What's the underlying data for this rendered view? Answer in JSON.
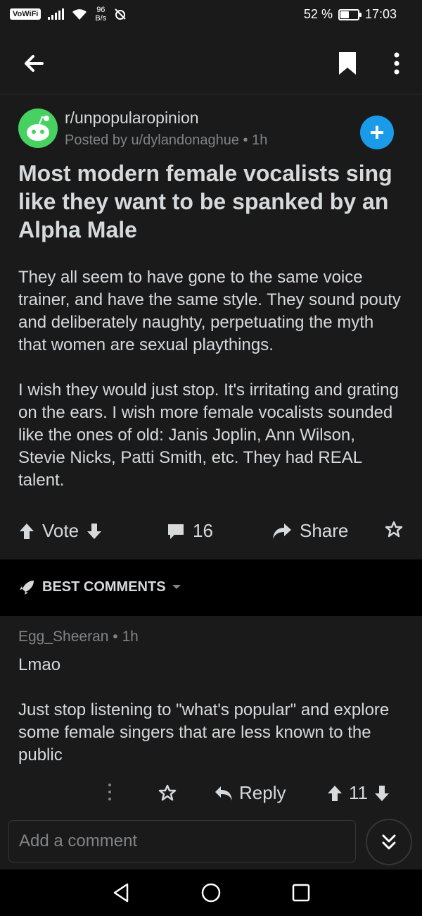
{
  "status": {
    "carrier_badge": "VoWiFi",
    "speed_value": "96",
    "speed_unit": "B/s",
    "battery_percent": "52 %",
    "battery_level": 0.52,
    "time": "17:03"
  },
  "appbar": {
    "back_icon": "arrow-left-icon",
    "bookmark_icon": "bookmark-icon",
    "more_icon": "more-vertical-icon"
  },
  "post": {
    "subreddit": "r/unpopularopinion",
    "byline": "Posted by u/dylandonaghue • 1h",
    "title": "Most modern female vocalists sing like they want to be spanked by an Alpha Male",
    "paragraphs": [
      "They all seem to have gone to the same voice trainer, and have the same style. They sound pouty and deliberately naughty, perpetuating the myth that women are sexual playthings.",
      "I wish they would just stop. It's irritating and grating on the ears. I wish more female vocalists sounded like the ones of old: Janis Joplin, Ann Wilson, Stevie Nicks, Patti Smith, etc. They had REAL talent."
    ],
    "vote_label": "Vote",
    "comment_count": "16",
    "share_label": "Share"
  },
  "sort": {
    "label": "BEST COMMENTS"
  },
  "comment": {
    "author_line": "Egg_Sheeran • 1h",
    "paragraphs": [
      "Lmao",
      "Just stop listening to \"what's popular\" and explore some female singers that are less known to the public"
    ],
    "reply_label": "Reply",
    "score": "11"
  },
  "composer": {
    "placeholder": "Add a comment"
  },
  "colors": {
    "background": "#1a1a1b",
    "text": "#d7dadc",
    "muted": "#818384",
    "join_button": "#1a9be9",
    "avatar": "#46d160"
  }
}
